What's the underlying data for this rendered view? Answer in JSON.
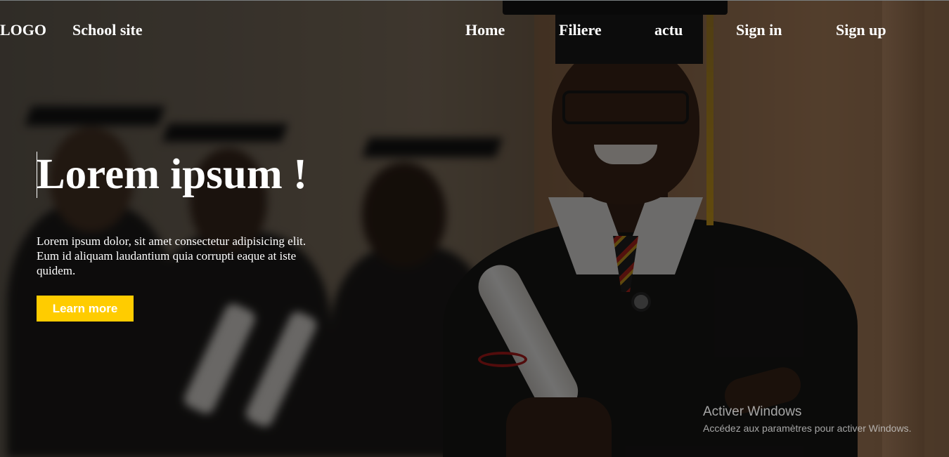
{
  "nav": {
    "logo": "LOGO",
    "site_name": "School site",
    "links": [
      "Home",
      "Filiere",
      "actu",
      "Sign in",
      "Sign up"
    ]
  },
  "hero": {
    "title": "Lorem ipsum !",
    "text": "Lorem ipsum dolor, sit amet consectetur adipisicing elit. Eum id aliquam laudantium quia corrupti eaque at iste quidem.",
    "cta_label": "Learn more",
    "background_image": "graduate-students-photo"
  },
  "watermark": {
    "title": "Activer Windows",
    "subtitle": "Accédez aux paramètres pour activer Windows."
  },
  "colors": {
    "accent": "#ffcc00",
    "text": "#ffffff",
    "overlay": "rgba(0,0,0,0.55)"
  }
}
